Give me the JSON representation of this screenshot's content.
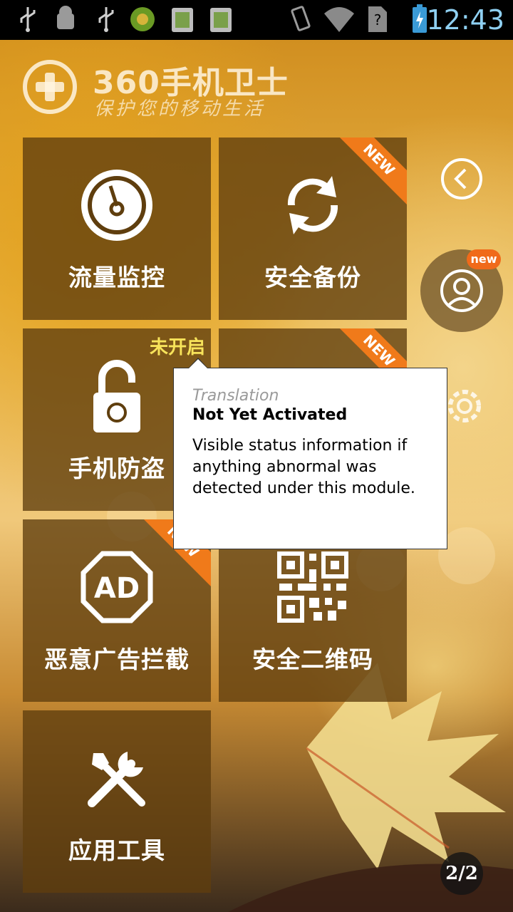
{
  "status_bar": {
    "time": "12:43",
    "icons": [
      "usb-icon",
      "android-debug-icon",
      "usb-icon",
      "app-notification-icon",
      "app-notification-icon",
      "app-notification-icon",
      "vibrate-icon",
      "wifi-icon",
      "no-sim-icon",
      "battery-charging-icon"
    ]
  },
  "header": {
    "brand": "360手机卫士",
    "slogan": "保护您的移动生活"
  },
  "tiles": [
    {
      "label": "流量监控",
      "icon": "speedometer-icon",
      "badge": ""
    },
    {
      "label": "安全备份",
      "icon": "sync-icon",
      "badge": "NEW"
    },
    {
      "label": "手机防盗",
      "icon": "unlocked-padlock-icon",
      "status": "未开启"
    },
    {
      "label": "",
      "icon": "shield-icon",
      "badge": "NEW"
    },
    {
      "label": "恶意广告拦截",
      "icon": "ad-block-icon",
      "badge": "NEW"
    },
    {
      "label": "安全二维码",
      "icon": "qr-code-icon",
      "badge": ""
    },
    {
      "label": "应用工具",
      "icon": "tools-icon",
      "badge": ""
    }
  ],
  "side": {
    "user_badge": "new",
    "pager": "2/2"
  },
  "tooltip": {
    "kicker": "Translation",
    "title": "Not Yet Activated",
    "body": "Visible status information if anything abnormal was detected under this module."
  },
  "colors": {
    "tile_bg": "#5f3e0e",
    "ribbon": "#f07a1a",
    "status_text": "#f7e35a",
    "clock": "#8fd0f2"
  }
}
